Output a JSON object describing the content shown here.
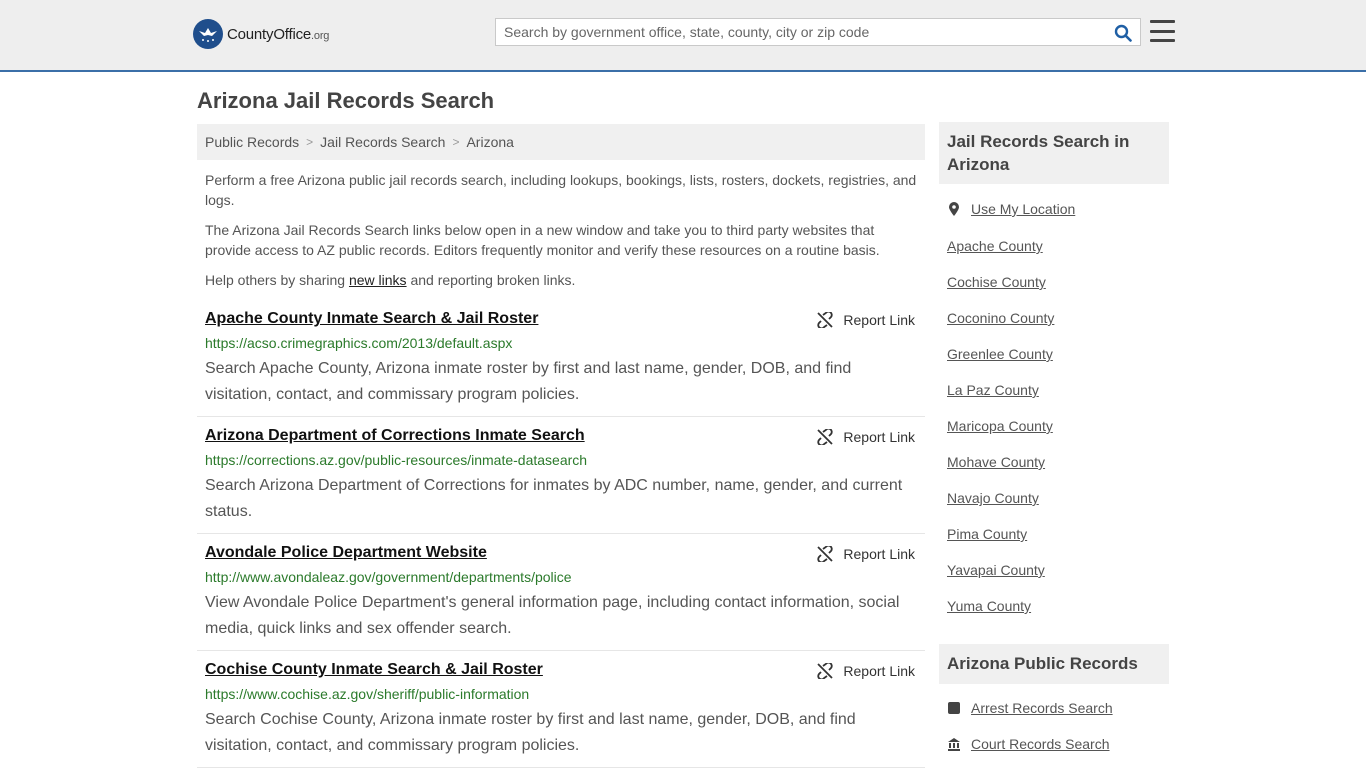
{
  "header": {
    "logo_main": "CountyOffice",
    "logo_tld": ".org",
    "search_placeholder": "Search by government office, state, county, city or zip code"
  },
  "page_title": "Arizona Jail Records Search",
  "breadcrumb": [
    "Public Records",
    "Jail Records Search",
    "Arizona"
  ],
  "intro": {
    "p1": "Perform a free Arizona public jail records search, including lookups, bookings, lists, rosters, dockets, registries, and logs.",
    "p2": "The Arizona Jail Records Search links below open in a new window and take you to third party websites that provide access to AZ public records. Editors frequently monitor and verify these resources on a routine basis.",
    "p3_before": "Help others by sharing ",
    "p3_link": "new links",
    "p3_after": " and reporting broken links."
  },
  "report_label": "Report Link",
  "results": [
    {
      "title": "Apache County Inmate Search & Jail Roster",
      "url": "https://acso.crimegraphics.com/2013/default.aspx",
      "desc": "Search Apache County, Arizona inmate roster by first and last name, gender, DOB, and find visitation, contact, and commissary program policies."
    },
    {
      "title": "Arizona Department of Corrections Inmate Search",
      "url": "https://corrections.az.gov/public-resources/inmate-datasearch",
      "desc": "Search Arizona Department of Corrections for inmates by ADC number, name, gender, and current status."
    },
    {
      "title": "Avondale Police Department Website",
      "url": "http://www.avondaleaz.gov/government/departments/police",
      "desc": "View Avondale Police Department's general information page, including contact information, social media, quick links and sex offender search."
    },
    {
      "title": "Cochise County Inmate Search & Jail Roster",
      "url": "https://www.cochise.az.gov/sheriff/public-information",
      "desc": "Search Cochise County, Arizona inmate roster by first and last name, gender, DOB, and find visitation, contact, and commissary program policies."
    }
  ],
  "sidebar": {
    "box1_title": "Jail Records Search in Arizona",
    "use_location": "Use My Location",
    "counties": [
      "Apache County",
      "Cochise County",
      "Coconino County",
      "Greenlee County",
      "La Paz County",
      "Maricopa County",
      "Mohave County",
      "Navajo County",
      "Pima County",
      "Yavapai County",
      "Yuma County"
    ],
    "box2_title": "Arizona Public Records",
    "public_records": [
      "Arrest Records Search",
      "Court Records Search"
    ]
  },
  "colors": {
    "header_bg": "#eeeeee",
    "header_border": "#3b6fa8",
    "url_green": "#2b7a2b",
    "logo_blue": "#1f4e8c"
  }
}
